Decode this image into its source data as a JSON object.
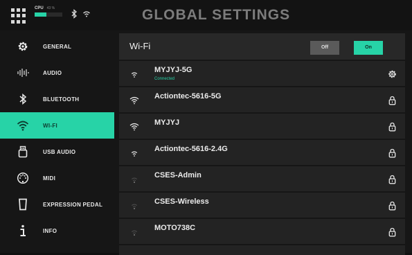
{
  "topbar": {
    "cpu_label": "CPU",
    "cpu_percent_text": "43 %",
    "cpu_level": 0.43,
    "bluetooth_icon": "bluetooth-icon",
    "wifi_icon": "wifi-icon",
    "title": "GLOBAL SETTINGS"
  },
  "sidebar": {
    "items": [
      {
        "label": "GENERAL",
        "icon": "gear-icon"
      },
      {
        "label": "AUDIO",
        "icon": "waveform-icon"
      },
      {
        "label": "BLUETOOTH",
        "icon": "bluetooth-icon"
      },
      {
        "label": "WI-FI",
        "icon": "wifi-icon"
      },
      {
        "label": "USB AUDIO",
        "icon": "usb-icon"
      },
      {
        "label": "MIDI",
        "icon": "midi-icon"
      },
      {
        "label": "EXPRESSION PEDAL",
        "icon": "pedal-icon"
      },
      {
        "label": "INFO",
        "icon": "info-icon"
      }
    ],
    "active": "WI-FI"
  },
  "wifi": {
    "label": "Wi-Fi",
    "off_label": "Off",
    "on_label": "On",
    "state": "On",
    "networks": [
      {
        "name": "MYJYJ-5G",
        "status": "Connected",
        "signal": "strong",
        "action": "gear-icon"
      },
      {
        "name": "Actiontec-5616-5G",
        "status": "",
        "signal": "full",
        "action": "lock-icon"
      },
      {
        "name": "MYJYJ",
        "status": "",
        "signal": "full",
        "action": "lock-icon"
      },
      {
        "name": "Actiontec-5616-2.4G",
        "status": "",
        "signal": "medium",
        "action": "lock-icon"
      },
      {
        "name": "CSES-Admin",
        "status": "",
        "signal": "weak",
        "action": "lock-icon"
      },
      {
        "name": "CSES-Wireless",
        "status": "",
        "signal": "weak",
        "action": "lock-icon"
      },
      {
        "name": "MOTO738C",
        "status": "",
        "signal": "weak",
        "action": "lock-icon"
      }
    ]
  },
  "colors": {
    "accent": "#27d3a7",
    "background": "#161616",
    "row": "#232323"
  }
}
